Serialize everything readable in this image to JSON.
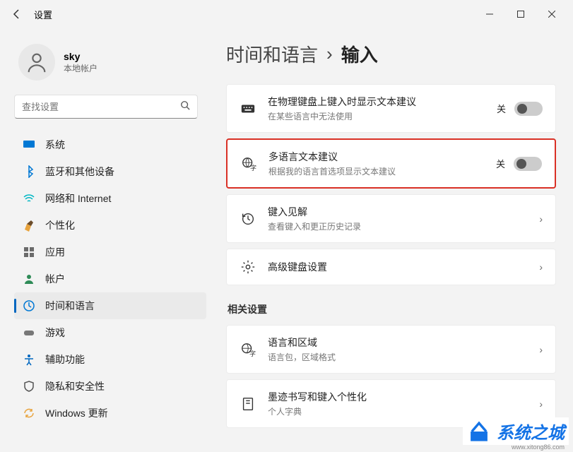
{
  "window": {
    "title": "设置"
  },
  "user": {
    "name": "sky",
    "subtitle": "本地帐户"
  },
  "search": {
    "placeholder": "查找设置"
  },
  "sidebar": {
    "items": [
      {
        "label": "系统"
      },
      {
        "label": "蓝牙和其他设备"
      },
      {
        "label": "网络和 Internet"
      },
      {
        "label": "个性化"
      },
      {
        "label": "应用"
      },
      {
        "label": "帐户"
      },
      {
        "label": "时间和语言"
      },
      {
        "label": "游戏"
      },
      {
        "label": "辅助功能"
      },
      {
        "label": "隐私和安全性"
      },
      {
        "label": "Windows 更新"
      }
    ]
  },
  "breadcrumb": {
    "parent": "时间和语言",
    "sep": "›",
    "current": "输入"
  },
  "settings": [
    {
      "title": "在物理键盘上键入时显示文本建议",
      "sub": "在某些语言中无法使用",
      "state": "关",
      "has_toggle": true,
      "has_chevron": false,
      "highlight": false
    },
    {
      "title": "多语言文本建议",
      "sub": "根据我的语言首选项显示文本建议",
      "state": "关",
      "has_toggle": true,
      "has_chevron": false,
      "highlight": true
    },
    {
      "title": "键入见解",
      "sub": "查看键入和更正历史记录",
      "state": "",
      "has_toggle": false,
      "has_chevron": true,
      "highlight": false
    },
    {
      "title": "高级键盘设置",
      "sub": "",
      "state": "",
      "has_toggle": false,
      "has_chevron": true,
      "highlight": false
    }
  ],
  "related": {
    "label": "相关设置",
    "items": [
      {
        "title": "语言和区域",
        "sub": "语言包，区域格式"
      },
      {
        "title": "墨迹书写和键入个性化",
        "sub": "个人字典"
      }
    ]
  },
  "watermark": {
    "text": "系统之城",
    "url": "www.xitong86.com"
  }
}
